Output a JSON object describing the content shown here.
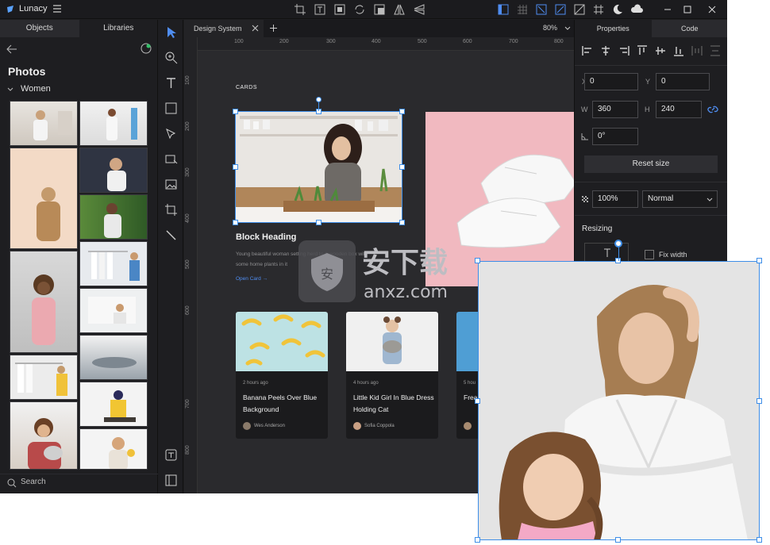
{
  "app": {
    "title": "Lunacy"
  },
  "left_panel": {
    "tabs": [
      "Objects",
      "Libraries"
    ],
    "section_title": "Photos",
    "category": "Women",
    "search_placeholder": "Search"
  },
  "document": {
    "tab_name": "Design System",
    "zoom": "80%"
  },
  "ruler": {
    "h_ticks": [
      "100",
      "200",
      "300",
      "400",
      "500",
      "600",
      "700",
      "800"
    ],
    "v_ticks": [
      "100",
      "200",
      "300",
      "400",
      "500",
      "600",
      "700",
      "800"
    ]
  },
  "canvas": {
    "section_label": "CARDS",
    "block_heading": "Block Heading",
    "block_text": "Young beautiful woman setting herd to a wooden box with some home plants in it",
    "open_card": "Open Card →",
    "cards": [
      {
        "time": "2 hours ago",
        "title": "Banana Peels Over Blue Background",
        "author": "Wes Anderson"
      },
      {
        "time": "4 hours ago",
        "title": "Little Kid Girl In Blue Dress Holding Cat",
        "author": "Sofia Coppola"
      },
      {
        "time": "5 hou",
        "title": "Frea Lem",
        "author": ""
      }
    ]
  },
  "right_panel": {
    "tabs": [
      "Properties",
      "Code"
    ],
    "x_label": "X",
    "x_value": "0",
    "y_label": "Y",
    "y_value": "0",
    "w_label": "W",
    "w_value": "360",
    "h_label": "H",
    "h_value": "240",
    "rotation": "0°",
    "reset_size": "Reset size",
    "opacity": "100%",
    "blend_mode": "Normal",
    "resizing_label": "Resizing",
    "fix_width": "Fix width"
  },
  "watermark": {
    "text_cn": "安下载",
    "text_url": "anxz.com"
  },
  "colors": {
    "accent": "#3e8ee8",
    "link": "#4f8df1",
    "pink_card": "#f1b9c0"
  }
}
